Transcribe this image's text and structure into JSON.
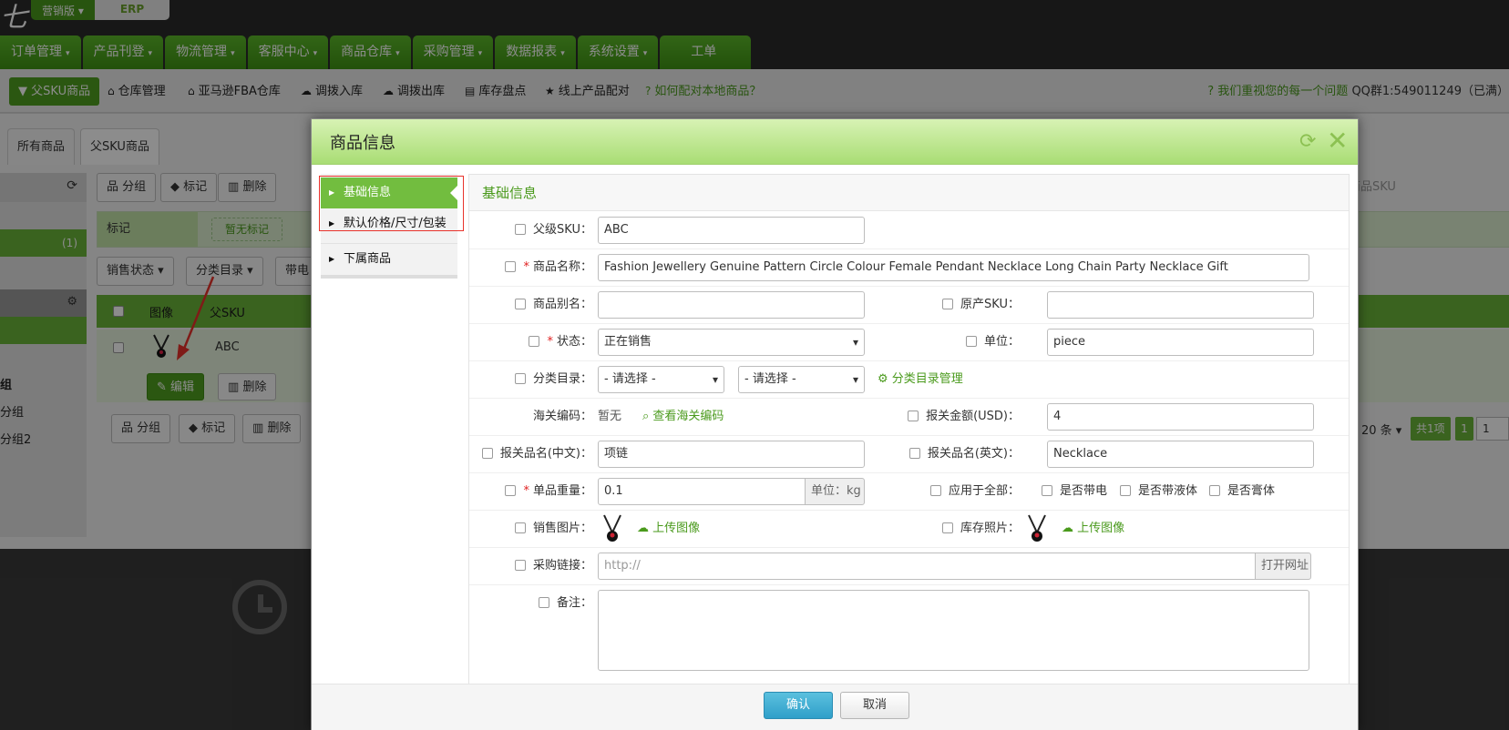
{
  "header": {
    "logo_fragment": "七",
    "edition": "营销版",
    "erp_label": "ERP",
    "nav": [
      {
        "label": "订单管理",
        "caret": "▾"
      },
      {
        "label": "产品刊登",
        "caret": "▾"
      },
      {
        "label": "物流管理",
        "caret": "▾"
      },
      {
        "label": "客服中心",
        "caret": "▾"
      },
      {
        "label": "商品仓库",
        "caret": "▾"
      },
      {
        "label": "采购管理",
        "caret": "▾"
      },
      {
        "label": "数据报表",
        "caret": "▾"
      },
      {
        "label": "系统设置",
        "caret": "▾"
      },
      {
        "label": "工单",
        "caret": ""
      }
    ]
  },
  "subnav": {
    "active": "父SKU商品",
    "items": [
      {
        "label": "仓库管理",
        "icon": "home-icon",
        "glyph": "⌂"
      },
      {
        "label": "亚马逊FBA仓库",
        "icon": "home-icon",
        "glyph": "⌂"
      },
      {
        "label": "调拨入库",
        "icon": "cloud-upload-icon",
        "glyph": "☁"
      },
      {
        "label": "调拨出库",
        "icon": "cloud-download-icon",
        "glyph": "☁"
      },
      {
        "label": "库存盘点",
        "icon": "list-icon",
        "glyph": "▤"
      },
      {
        "label": "线上产品配对",
        "icon": "star-icon",
        "glyph": "★"
      }
    ],
    "help": "如何配对本地商品？",
    "qq_prefix": "我们重视您的每一个问题",
    "qq_text": "QQ群1:549011249（已满）"
  },
  "background": {
    "tabs": [
      "所有商品",
      "父SKU商品"
    ],
    "left_count": "(1)",
    "left_groups": [
      "组",
      "分组",
      "分组2"
    ],
    "toolbar": [
      "分组",
      "标记",
      "删除"
    ],
    "mark_label": "标记",
    "mark_none": "暂无标记",
    "filters": [
      "销售状态 ▾",
      "分类目录 ▾",
      "带电"
    ],
    "table_headers": [
      "图像",
      "父SKU"
    ],
    "row_sku": "ABC",
    "row_edit": "编辑",
    "row_delete": "删除",
    "bottom_toolbar": [
      "分组",
      "标记",
      "删除"
    ],
    "search_placeholder": "商品SKU",
    "pagination": {
      "per_page": "20 条 ▾",
      "total": "共1项",
      "page": "1",
      "page_input": "1"
    }
  },
  "modal": {
    "title": "商品信息",
    "sidebar": [
      {
        "label": "基础信息",
        "active": true
      },
      {
        "label": "默认价格/尺寸/包装",
        "active": false
      },
      {
        "label": "下属商品",
        "active": false
      }
    ],
    "section_title": "基础信息",
    "fields": {
      "parent_sku": {
        "label": "父级SKU：",
        "value": "ABC"
      },
      "product_name": {
        "label": "商品名称：",
        "value": "Fashion Jewellery Genuine Pattern Circle Colour Female Pendant Necklace Long Chain Party Necklace Gift"
      },
      "alias": {
        "label": "商品别名：",
        "value": ""
      },
      "original_sku": {
        "label": "原产SKU：",
        "value": ""
      },
      "status": {
        "label": "状态：",
        "value": "正在销售"
      },
      "unit": {
        "label": "单位：",
        "value": "piece"
      },
      "category": {
        "label": "分类目录：",
        "select1": "- 请选择 -",
        "select2": "- 请选择 -",
        "manage_link": "分类目录管理"
      },
      "customs_code": {
        "label": "海关编码：",
        "value": "暂无",
        "lookup_link": "查看海关编码"
      },
      "declared_amount": {
        "label": "报关金额(USD)：",
        "value": "4"
      },
      "declared_name_cn": {
        "label": "报关品名(中文)：",
        "value": "项链"
      },
      "declared_name_en": {
        "label": "报关品名(英文)：",
        "value": "Necklace"
      },
      "weight": {
        "label": "单品重量：",
        "value": "0.1",
        "unit": "单位：kg"
      },
      "apply_all": {
        "label": "应用于全部：",
        "options": [
          "是否带电",
          "是否带液体",
          "是否膏体"
        ]
      },
      "sales_image": {
        "label": "销售图片：",
        "upload": "上传图像"
      },
      "stock_image": {
        "label": "库存照片：",
        "upload": "上传图像"
      },
      "purchase_link": {
        "label": "采购链接：",
        "placeholder": "http://",
        "open_button": "打开网址"
      },
      "notes": {
        "label": "备注：",
        "value": ""
      }
    },
    "buttons": {
      "confirm": "确认",
      "cancel": "取消"
    }
  },
  "colors": {
    "brand_green": "#4a9a1c",
    "nav_green": "#5cb82a",
    "modal_header": "#a9dd74",
    "confirm_blue": "#2f9fc9",
    "required_red": "#e02020",
    "annotation_red": "#e8322a"
  }
}
